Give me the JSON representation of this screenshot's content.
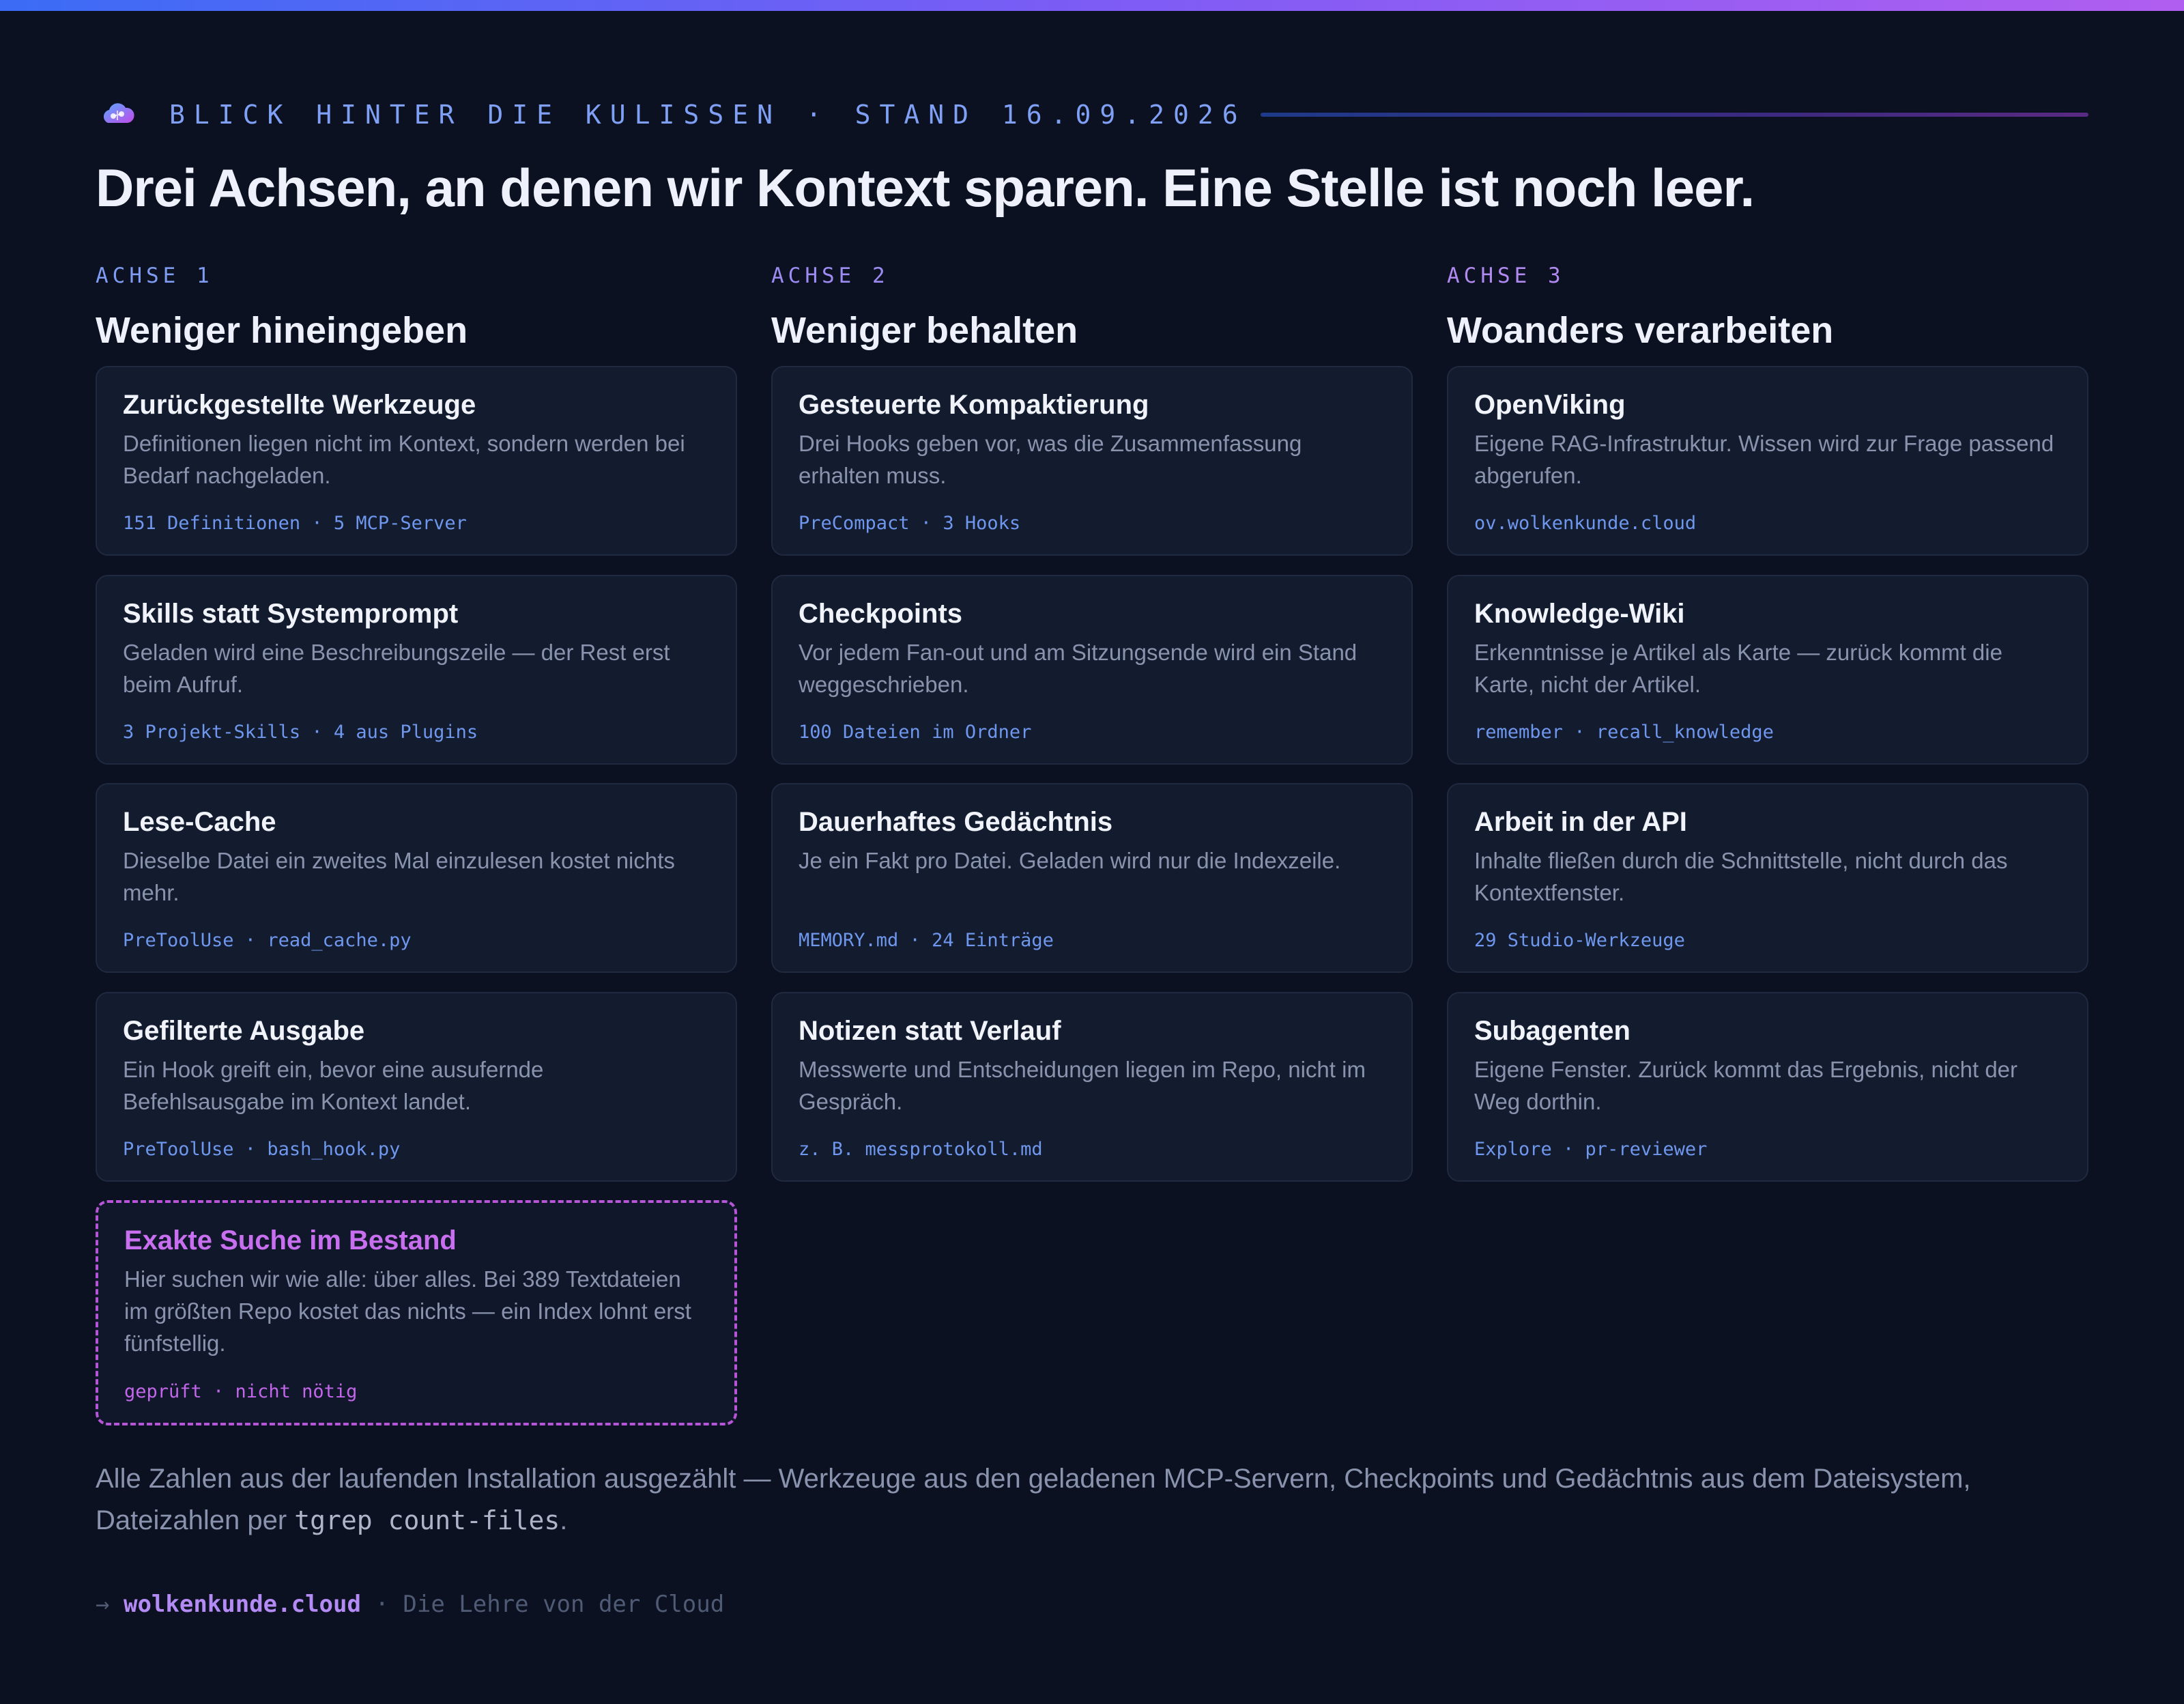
{
  "header": {
    "kicker": "BLICK HINTER DIE KULISSEN · STAND 16.09.2026",
    "title": "Drei Achsen, an denen wir Kontext sparen. Eine Stelle ist noch leer.",
    "logo_icon": "cloud-brain-icon"
  },
  "axes": [
    {
      "label": "ACHSE 1",
      "title": "Weniger hineingeben",
      "cards": [
        {
          "title": "Zurückgestellte Werkzeuge",
          "desc": "Definitionen liegen nicht im Kontext, sondern werden bei Bedarf nachgeladen.",
          "meta": "151 Definitionen · 5 MCP-Server"
        },
        {
          "title": "Skills statt Systemprompt",
          "desc": "Geladen wird eine Beschreibungszeile — der Rest erst beim Aufruf.",
          "meta": "3 Projekt-Skills · 4 aus Plugins"
        },
        {
          "title": "Lese-Cache",
          "desc": "Dieselbe Datei ein zweites Mal einzulesen kostet nichts mehr.",
          "meta": "PreToolUse · read_cache.py"
        },
        {
          "title": "Gefilterte Ausgabe",
          "desc": "Ein Hook greift ein, bevor eine ausufernde Befehlsausgabe im Kontext landet.",
          "meta": "PreToolUse · bash_hook.py"
        },
        {
          "title": "Exakte Suche im Bestand",
          "desc": "Hier suchen wir wie alle: über alles. Bei 389 Textdateien im größten Repo kostet das nichts — ein Index lohnt erst fünfstellig.",
          "meta": "geprüft · nicht nötig"
        }
      ]
    },
    {
      "label": "ACHSE 2",
      "title": "Weniger behalten",
      "cards": [
        {
          "title": "Gesteuerte Kompaktierung",
          "desc": "Drei Hooks geben vor, was die Zusammenfassung erhalten muss.",
          "meta": "PreCompact · 3 Hooks"
        },
        {
          "title": "Checkpoints",
          "desc": "Vor jedem Fan-out und am Sitzungsende wird ein Stand weggeschrieben.",
          "meta": "100 Dateien im Ordner"
        },
        {
          "title": "Dauerhaftes Gedächtnis",
          "desc": "Je ein Fakt pro Datei. Geladen wird nur die Indexzeile.",
          "meta": "MEMORY.md · 24 Einträge"
        },
        {
          "title": "Notizen statt Verlauf",
          "desc": "Messwerte und Entscheidungen liegen im Repo, nicht im Gespräch.",
          "meta": "z. B. messprotokoll.md"
        }
      ]
    },
    {
      "label": "ACHSE 3",
      "title": "Woanders verarbeiten",
      "cards": [
        {
          "title": "OpenViking",
          "desc": "Eigene RAG-Infrastruktur. Wissen wird zur Frage passend abgerufen.",
          "meta": "ov.wolkenkunde.cloud"
        },
        {
          "title": "Knowledge-Wiki",
          "desc": "Erkenntnisse je Artikel als Karte — zurück kommt die Karte, nicht der Artikel.",
          "meta": "remember · recall_knowledge"
        },
        {
          "title": "Arbeit in der API",
          "desc": "Inhalte fließen durch die Schnittstelle, nicht durch das Kontextfenster.",
          "meta": "29 Studio-Werkzeuge"
        },
        {
          "title": "Subagenten",
          "desc": "Eigene Fenster. Zurück kommt das Ergebnis, nicht der Weg dorthin.",
          "meta": "Explore · pr-reviewer"
        }
      ]
    }
  ],
  "footnote": {
    "text": "Alle Zahlen aus der laufenden Installation ausgezählt — Werkzeuge aus den geladenen MCP-Servern, Checkpoints und Gedächtnis aus dem Dateisystem, Dateizahlen per ",
    "code": "tgrep count-files",
    "end": "."
  },
  "footer": {
    "arrow": "→",
    "domain": "wolkenkunde.cloud",
    "tagline": " · Die Lehre von der Cloud"
  }
}
